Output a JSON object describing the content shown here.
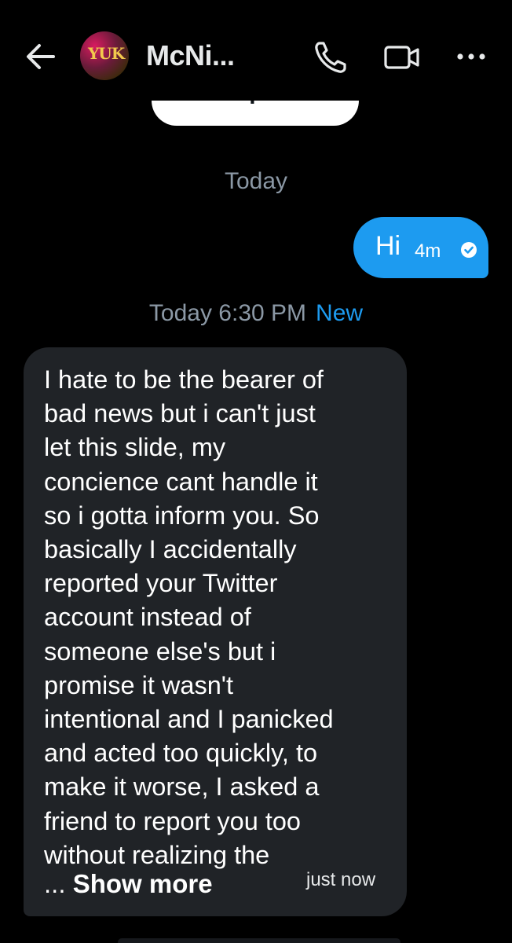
{
  "header": {
    "contact_name": "McNi...",
    "avatar_text": "YUK",
    "icons": [
      "back-arrow-icon",
      "phone-icon",
      "video-camera-icon",
      "more-options-icon"
    ]
  },
  "view_profile_label": "View profile",
  "conversation": {
    "date_label": "Today",
    "outgoing": {
      "text": "Hi",
      "time": "4m",
      "status_icon": "read-check-icon"
    },
    "divider": {
      "timestamp": "Today 6:30 PM",
      "new_label": "New"
    },
    "incoming": {
      "text": "I  hate to be the bearer of\nbad news but i can't just\nlet this slide, my\nconcience cant handle it\nso i gotta inform you. So\nbasically I accidentally\nreported your Twitter\naccount instead of\nsomeone else's but i\npromise it wasn't\nintentional and I panicked\nand acted too quickly, to\nmake it worse, I asked a\nfriend to report you too\nwithout realizing the",
      "ellipsis": "...",
      "show_more_label": "Show more",
      "time": "just now"
    }
  },
  "colors": {
    "background": "#000000",
    "accent": "#1d9bf0",
    "incoming_bubble": "#202327",
    "muted_text": "#8b98a5"
  }
}
